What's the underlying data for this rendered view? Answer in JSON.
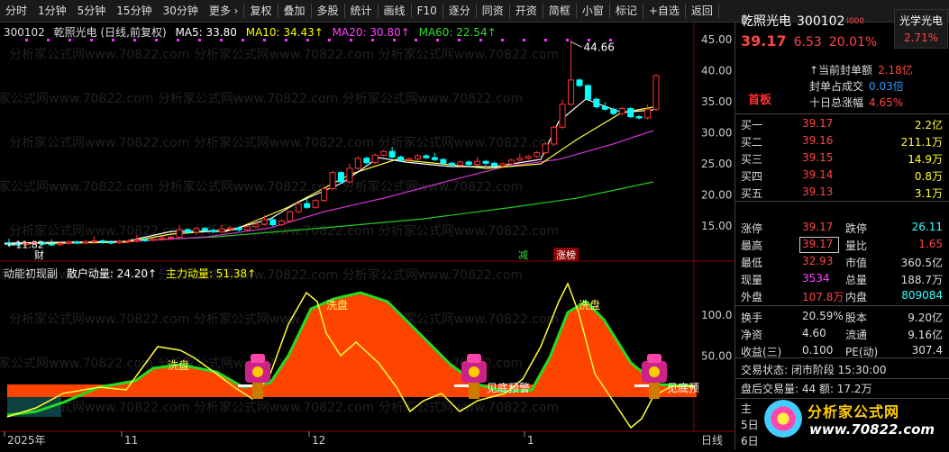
{
  "toolbar": {
    "left_items": [
      "分时",
      "1分钟",
      "5分钟",
      "15分钟",
      "30分钟",
      "更多 ›"
    ],
    "right_items": [
      "复权",
      "叠加",
      "多股",
      "统计",
      "画线",
      "F10",
      "逐分",
      "同资",
      "开资",
      "简框",
      "小窗",
      "标记",
      "+自选",
      "返回"
    ]
  },
  "chart_header": {
    "code": "300102",
    "name_mode": "乾照光电 (日线,前复权)",
    "ma5": "MA5: 33.80",
    "ma10": "MA10: 34.43↑",
    "ma20": "MA20: 30.80↑",
    "ma60": "MA60: 22.54↑"
  },
  "price_axis_labels": [
    "45.00",
    "40.00",
    "35.00",
    "30.00",
    "25.00",
    "20.00",
    "15.00"
  ],
  "max_price_label": "44.66",
  "min_price_label": "←11.82",
  "chart_markers": {
    "cai": "财",
    "jian": "减",
    "zhangbang": "涨榜"
  },
  "indicator_header": {
    "name": "动能初现副",
    "retail": "散户动量: 24.20↑",
    "main": "主力动量: 51.38↑"
  },
  "indicator_axis_labels": [
    "100.0",
    "50.00"
  ],
  "indicator_annotations": {
    "xipan1": "洗盘",
    "xipan2": "洗盘",
    "xipan3": "洗盘",
    "bottom_signal": "见底预警",
    "bottom_signal_2": "见底预"
  },
  "date_labels": [
    "2025年",
    "11",
    "12",
    "1"
  ],
  "period_label": "日线",
  "watermark": "分析家公式网www.70822.com",
  "side": {
    "name": "乾照光电",
    "code": "300102",
    "tag": "l000",
    "sector": "光学光电",
    "sector_pct": "2.71%",
    "price": "39.17",
    "change": "6.53",
    "change_pct": "20.01%",
    "shouban": "首板",
    "seal_rows": [
      {
        "label": "当前封单额",
        "value": "2.18亿"
      },
      {
        "label": "封单占成交",
        "value": "0.03倍"
      },
      {
        "label": "十日总涨幅",
        "value": "4.65%"
      }
    ],
    "sells": [
      {
        "label": "卖五",
        "price": "",
        "vol": ""
      },
      {
        "label": "卖四",
        "price": "",
        "vol": ""
      },
      {
        "label": "卖三",
        "price": "",
        "vol": ""
      },
      {
        "label": "卖二",
        "price": "",
        "vol": ""
      },
      {
        "label": "卖一",
        "price": "",
        "vol": ""
      }
    ],
    "buys": [
      {
        "label": "买一",
        "price": "39.17",
        "vol": "2.2亿"
      },
      {
        "label": "买二",
        "price": "39.16",
        "vol": "211.1万"
      },
      {
        "label": "买三",
        "price": "39.15",
        "vol": "14.9万"
      },
      {
        "label": "买四",
        "price": "39.14",
        "vol": "0.8万"
      },
      {
        "label": "买五",
        "price": "39.13",
        "vol": "3.1万"
      }
    ],
    "stats": [
      {
        "l1": "涨停",
        "v1": "39.17",
        "l2": "跌停",
        "v2": "26.11"
      },
      {
        "l1": "最高",
        "v1": "39.17",
        "l2": "量比",
        "v2": "1.65"
      },
      {
        "l1": "最低",
        "v1": "32.93",
        "l2": "市值",
        "v2": "360.5亿"
      },
      {
        "l1": "现量",
        "v1": "3534",
        "l2": "总量",
        "v2": "188.7万"
      },
      {
        "l1": "外盘",
        "v1": "107.8万",
        "l2": "内盘",
        "v2": "809084"
      }
    ],
    "stats2": [
      {
        "l1": "换手",
        "v1": "20.59%",
        "l2": "股本",
        "v2": "9.20亿"
      },
      {
        "l1": "净资",
        "v1": "4.60",
        "l2": "流通",
        "v2": "9.16亿"
      },
      {
        "l1": "收益(三)",
        "v1": "0.100",
        "l2": "PE(动)",
        "v2": "307.4"
      }
    ],
    "trade_state": "交易状态: 闭市阶段 15:30:00",
    "after_hours": "盘后交易量: 44  额: 17.2万",
    "partial1": "主",
    "partial2": "5日",
    "partial3": "6日",
    "logo_text": "分析家公式网",
    "logo_url": "www.70822.com"
  },
  "colors": {
    "up": "#ff3333",
    "down": "#00ffff",
    "ma5": "#ffffff",
    "ma10": "#ffff00",
    "ma20": "#ff00ff",
    "ma60": "#00cc00",
    "fill": "#ff4400",
    "green": "#22dd22"
  }
}
